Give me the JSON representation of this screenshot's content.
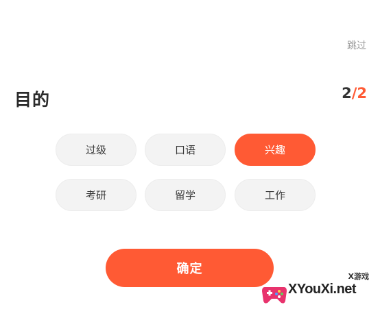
{
  "header": {
    "skip_label": "跳过"
  },
  "question": {
    "title": "目的",
    "progress_current": "2",
    "progress_sep": "/",
    "progress_total": "2"
  },
  "options": [
    {
      "label": "过级",
      "selected": false
    },
    {
      "label": "口语",
      "selected": false
    },
    {
      "label": "兴趣",
      "selected": true
    },
    {
      "label": "考研",
      "selected": false
    },
    {
      "label": "留学",
      "selected": false
    },
    {
      "label": "工作",
      "selected": false
    }
  ],
  "confirm_label": "确定",
  "watermark": {
    "site": "XYouXi.net",
    "tag": "X游戏"
  },
  "colors": {
    "accent": "#ff5a34",
    "option_bg": "#f3f3f3",
    "text_dark": "#2b2b2b",
    "text_muted": "#9b9b9b"
  }
}
